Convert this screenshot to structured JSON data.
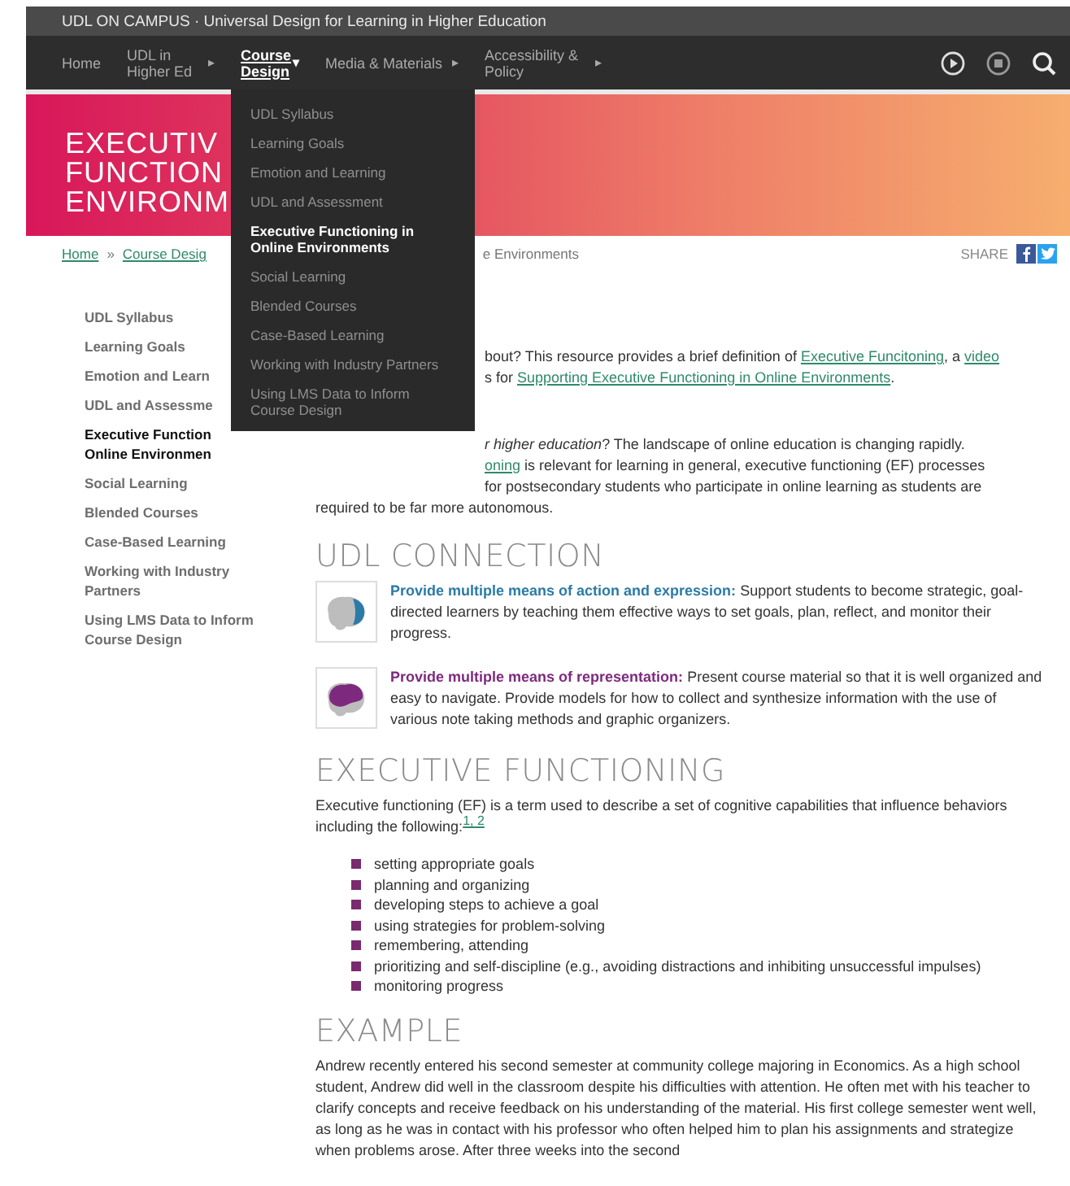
{
  "site_bar": {
    "title": "UDL ON CAMPUS · Universal Design for Learning in Higher Education"
  },
  "nav": {
    "items": [
      {
        "label": "Home",
        "selected": false
      },
      {
        "label": "UDL in Higher Ed",
        "arrow": "▸",
        "selected": false
      },
      {
        "label": "Course Design",
        "arrow": "▾",
        "selected": true
      },
      {
        "label": "Media & Materials",
        "arrow": "▸",
        "selected": false
      },
      {
        "label": "Accessibility & Policy",
        "arrow": "▸",
        "selected": false
      }
    ]
  },
  "hero": {
    "title_lines": [
      "EXECUTIV",
      "FUNCTION",
      "ENVIRONM"
    ]
  },
  "dropdown": {
    "items": [
      {
        "label": "UDL Syllabus",
        "selected": false
      },
      {
        "label": "Learning Goals",
        "selected": false
      },
      {
        "label": "Emotion and Learning",
        "selected": false
      },
      {
        "label": "UDL and Assessment",
        "selected": false
      },
      {
        "label": "Executive Functioning in Online Environments",
        "selected": true
      },
      {
        "label": "Social Learning",
        "selected": false
      },
      {
        "label": "Blended Courses",
        "selected": false
      },
      {
        "label": "Case-Based Learning",
        "selected": false
      },
      {
        "label": "Working with Industry Partners",
        "selected": false
      },
      {
        "label": "Using LMS Data to Inform Course Design",
        "selected": false
      }
    ]
  },
  "breadcrumb": {
    "items": [
      {
        "text": "Home",
        "kind": "link"
      },
      {
        "text": "»",
        "kind": "separator"
      },
      {
        "text": "Course Desig",
        "kind": "link"
      },
      {
        "text": "e Environments",
        "kind": "current"
      }
    ],
    "share_label": "SHARE"
  },
  "sidebar": {
    "items": [
      {
        "label": "UDL Syllabus",
        "selected": false
      },
      {
        "label": "Learning Goals",
        "selected": false
      },
      {
        "label": "Emotion and Learn",
        "selected": false
      },
      {
        "label": "UDL and Assessme",
        "selected": false
      },
      {
        "label": "Executive Function Online Environmen",
        "selected": true
      },
      {
        "label": "Social Learning",
        "selected": false
      },
      {
        "label": "Blended Courses",
        "selected": false
      },
      {
        "label": "Case-Based Learning",
        "selected": false
      },
      {
        "label": "Working with Industry Partners",
        "selected": false
      },
      {
        "label": "Using LMS Data to Inform Course Design",
        "selected": false
      }
    ]
  },
  "intro": [
    {
      "lines": [
        {
          "segments": [
            {
              "text": "bout? This resource provides a brief definition of ",
              "kind": "plain"
            },
            {
              "text": "Executive Funcitoning",
              "kind": "link"
            },
            {
              "text": ", a ",
              "kind": "plain"
            },
            {
              "text": "video",
              "kind": "link"
            }
          ]
        },
        {
          "segments": [
            {
              "text": "s for ",
              "kind": "plain"
            },
            {
              "text": "Supporting Executive Functioning in Online Environments",
              "kind": "link"
            },
            {
              "text": ".",
              "kind": "plain"
            }
          ]
        }
      ]
    },
    {
      "lines": [
        {
          "segments": [
            {
              "text": "r higher education",
              "kind": "italic"
            },
            {
              "text": "? The landscape of online education is changing rapidly.",
              "kind": "plain"
            }
          ]
        },
        {
          "segments": [
            {
              "text": "oning",
              "kind": "link"
            },
            {
              "text": " is relevant for learning in general, executive functioning (EF) processes",
              "kind": "plain"
            }
          ]
        },
        {
          "segments": [
            {
              "text": "for postsecondary students who participate in online learning as students are",
              "kind": "plain"
            }
          ]
        }
      ],
      "continuation": "required to be far more autonomous."
    }
  ],
  "udl_connection": {
    "heading": "UDL CONNECTION",
    "cards": [
      {
        "kind": "action",
        "color": "#2b7ba6",
        "lead": "Provide multiple means of action and expression:",
        "text": "Support students to become strategic, goal-directed learners by teaching them effective ways to set goals, plan, reflect, and monitor their progress."
      },
      {
        "kind": "representation",
        "color": "#7d2a7e",
        "lead": "Provide multiple means of representation:",
        "text": "Present course material so that it is well organized and easy to navigate. Provide models for how to collect and synthesize information with the use of various note taking methods and graphic organizers."
      }
    ]
  },
  "executive_functioning": {
    "heading": "EXECUTIVE FUNCTIONING",
    "text": "Executive functioning (EF) is a term used to describe a set of cognitive capabilities that influence behaviors including the following:",
    "refs": "1, 2",
    "list": [
      "setting appropriate goals",
      "planning and organizing",
      "developing steps to achieve a goal",
      "using strategies for problem-solving",
      "remembering, attending",
      "prioritizing and self-discipline (e.g., avoiding distractions and inhibiting unsuccessful impulses)",
      "monitoring progress"
    ]
  },
  "example": {
    "heading": "EXAMPLE",
    "text": "Andrew recently entered his second semester at community college majoring in Economics. As a high school student, Andrew did well in the classroom despite his difficulties with attention. He often met with his teacher to clarify concepts and receive feedback on his understanding of the material. His first college semester went well, as long as he was in contact with his professor who often helped him to plan his assignments and strategize when problems arose. After three weeks into the second"
  }
}
